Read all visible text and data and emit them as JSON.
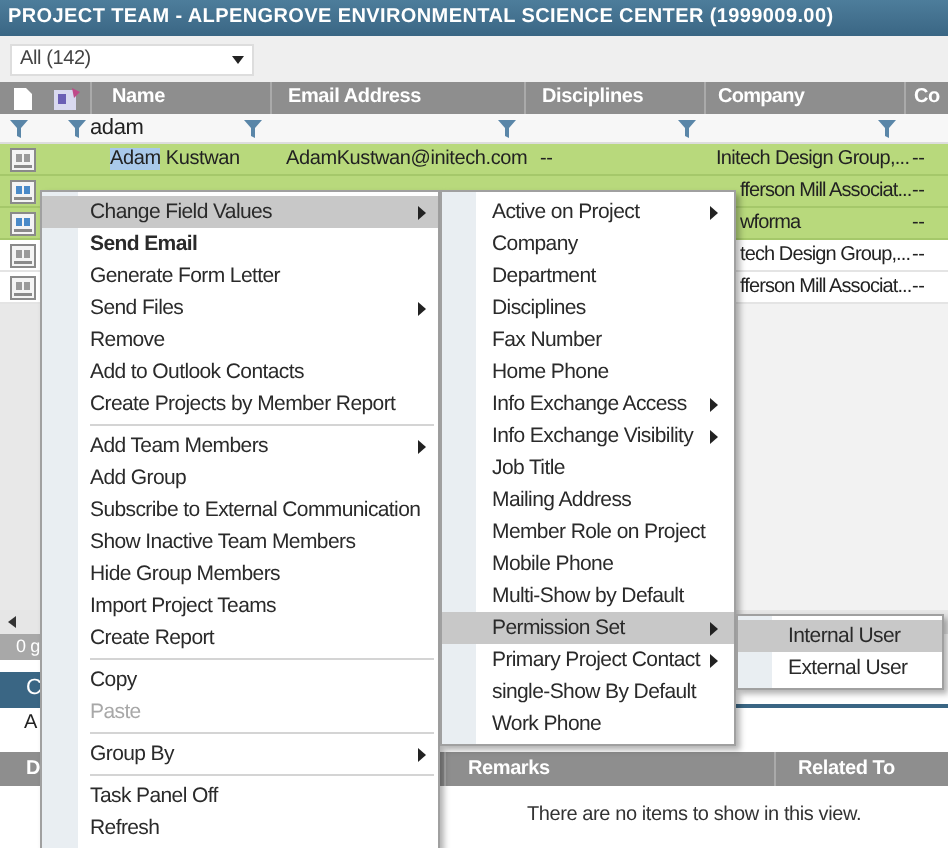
{
  "window": {
    "title": "PROJECT TEAM - ALPENGROVE ENVIRONMENTAL SCIENCE CENTER (1999009.00)"
  },
  "view_select": {
    "value": "All (142)"
  },
  "table": {
    "columns": [
      "Name",
      "Email Address",
      "Disciplines",
      "Company",
      "Co"
    ],
    "filter": {
      "value": "adam"
    },
    "rows": [
      {
        "kind": "full",
        "selected": true,
        "name_match": "Adam",
        "name_rest": " Kustwan",
        "email": "AdamKustwan@initech.com",
        "disciplines": "--",
        "company": "Initech Design Group,...",
        "column_5": "--"
      },
      {
        "kind": "partial",
        "selected": true,
        "company": "fferson Mill Associat...",
        "column_5": "--"
      },
      {
        "kind": "partial",
        "selected": true,
        "company": "wforma",
        "column_5": "--"
      },
      {
        "kind": "partial",
        "selected": false,
        "company": "tech Design Group,...",
        "column_5": "--"
      },
      {
        "kind": "partial",
        "selected": false,
        "company": "fferson Mill Associat...",
        "column_5": "--"
      }
    ]
  },
  "status_bar": {
    "text": "0 g"
  },
  "lower_panel": {
    "tab": "C",
    "field": "A",
    "columns": [
      "D",
      "Remarks",
      "Related To"
    ],
    "empty_message": "There are no items to show in this view."
  },
  "context_menu": {
    "items": [
      {
        "kind": "item",
        "label": "Change Field Values",
        "submenu": true,
        "highlighted": true,
        "disabled": false
      },
      {
        "kind": "default",
        "label": "Send Email",
        "submenu": false,
        "highlighted": false,
        "disabled": false
      },
      {
        "kind": "item",
        "label": "Generate Form Letter",
        "submenu": false,
        "highlighted": false,
        "disabled": false
      },
      {
        "kind": "item",
        "label": "Send Files",
        "submenu": true,
        "highlighted": false,
        "disabled": false
      },
      {
        "kind": "item",
        "label": "Remove",
        "submenu": false,
        "highlighted": false,
        "disabled": false
      },
      {
        "kind": "item",
        "label": "Add to Outlook Contacts",
        "submenu": false,
        "highlighted": false,
        "disabled": false
      },
      {
        "kind": "item",
        "label": "Create Projects by Member Report",
        "submenu": false,
        "highlighted": false,
        "disabled": false
      },
      {
        "kind": "separator"
      },
      {
        "kind": "item",
        "label": "Add Team Members",
        "submenu": true,
        "highlighted": false,
        "disabled": false
      },
      {
        "kind": "item",
        "label": "Add Group",
        "submenu": false,
        "highlighted": false,
        "disabled": false
      },
      {
        "kind": "item",
        "label": "Subscribe to External Communication",
        "submenu": false,
        "highlighted": false,
        "disabled": false
      },
      {
        "kind": "item",
        "label": "Show Inactive Team Members",
        "submenu": false,
        "highlighted": false,
        "disabled": false
      },
      {
        "kind": "item",
        "label": "Hide Group Members",
        "submenu": false,
        "highlighted": false,
        "disabled": false
      },
      {
        "kind": "item",
        "label": "Import Project Teams",
        "submenu": false,
        "highlighted": false,
        "disabled": false
      },
      {
        "kind": "item",
        "label": "Create Report",
        "submenu": false,
        "highlighted": false,
        "disabled": false
      },
      {
        "kind": "separator"
      },
      {
        "kind": "item",
        "label": "Copy",
        "submenu": false,
        "highlighted": false,
        "disabled": false
      },
      {
        "kind": "item",
        "label": "Paste",
        "submenu": false,
        "highlighted": false,
        "disabled": true
      },
      {
        "kind": "separator"
      },
      {
        "kind": "item",
        "label": "Group By",
        "submenu": true,
        "highlighted": false,
        "disabled": false
      },
      {
        "kind": "separator"
      },
      {
        "kind": "item",
        "label": "Task Panel Off",
        "submenu": false,
        "highlighted": false,
        "disabled": false
      },
      {
        "kind": "item",
        "label": "Refresh",
        "submenu": false,
        "highlighted": false,
        "disabled": false
      }
    ]
  },
  "field_submenu": {
    "items": [
      {
        "kind": "item",
        "label": "Active on Project",
        "submenu": true,
        "highlighted": false,
        "disabled": false
      },
      {
        "kind": "item",
        "label": "Company",
        "submenu": false,
        "highlighted": false,
        "disabled": false
      },
      {
        "kind": "item",
        "label": "Department",
        "submenu": false,
        "highlighted": false,
        "disabled": false
      },
      {
        "kind": "item",
        "label": "Disciplines",
        "submenu": false,
        "highlighted": false,
        "disabled": false
      },
      {
        "kind": "item",
        "label": "Fax Number",
        "submenu": false,
        "highlighted": false,
        "disabled": false
      },
      {
        "kind": "item",
        "label": "Home Phone",
        "submenu": false,
        "highlighted": false,
        "disabled": false
      },
      {
        "kind": "item",
        "label": "Info Exchange Access",
        "submenu": true,
        "highlighted": false,
        "disabled": false
      },
      {
        "kind": "item",
        "label": "Info Exchange Visibility",
        "submenu": true,
        "highlighted": false,
        "disabled": false
      },
      {
        "kind": "item",
        "label": "Job Title",
        "submenu": false,
        "highlighted": false,
        "disabled": false
      },
      {
        "kind": "item",
        "label": "Mailing Address",
        "submenu": false,
        "highlighted": false,
        "disabled": false
      },
      {
        "kind": "item",
        "label": "Member Role on Project",
        "submenu": false,
        "highlighted": false,
        "disabled": false
      },
      {
        "kind": "item",
        "label": "Mobile Phone",
        "submenu": false,
        "highlighted": false,
        "disabled": false
      },
      {
        "kind": "item",
        "label": "Multi-Show by Default",
        "submenu": false,
        "highlighted": false,
        "disabled": false
      },
      {
        "kind": "item",
        "label": "Permission Set",
        "submenu": true,
        "highlighted": true,
        "disabled": false
      },
      {
        "kind": "item",
        "label": "Primary Project Contact",
        "submenu": true,
        "highlighted": false,
        "disabled": false
      },
      {
        "kind": "item",
        "label": "single-Show By Default",
        "submenu": false,
        "highlighted": false,
        "disabled": false
      },
      {
        "kind": "item",
        "label": "Work Phone",
        "submenu": false,
        "highlighted": false,
        "disabled": false
      }
    ]
  },
  "permission_submenu": {
    "items": [
      {
        "kind": "item",
        "label": "Internal User",
        "submenu": false,
        "highlighted": true,
        "disabled": false
      },
      {
        "kind": "item",
        "label": "External User",
        "submenu": false,
        "highlighted": false,
        "disabled": false
      }
    ]
  }
}
